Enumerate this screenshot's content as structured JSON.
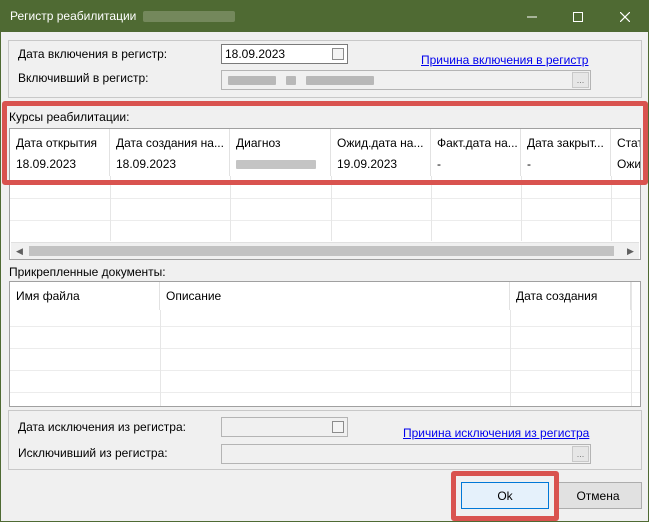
{
  "window": {
    "title": "Регистр реабилитации",
    "controls": {
      "minimize": "minimize",
      "maximize": "maximize",
      "close": "close"
    }
  },
  "inclusion": {
    "date_label": "Дата включения в регистр:",
    "date_value": "18.09.2023",
    "included_by_label": "Включивший в регистр:",
    "picker_button": "...",
    "reason_link": "Причина включения в регистр"
  },
  "courses": {
    "section_label": "Курсы реабилитации:",
    "columns": [
      "Дата открытия",
      "Дата создания на...",
      "Диагноз",
      "Ожид.дата на...",
      "Факт.дата на...",
      "Дата закрыт...",
      "Стат"
    ],
    "rows": [
      [
        "18.09.2023",
        "18.09.2023",
        "",
        "19.09.2023",
        "-",
        "-",
        "Ожи"
      ]
    ],
    "scroll_left": "◀",
    "scroll_right": "▶"
  },
  "documents": {
    "section_label": "Прикрепленные документы:",
    "columns": [
      "Имя файла",
      "Описание",
      "Дата создания"
    ]
  },
  "exclusion": {
    "date_label": "Дата исключения из регистра:",
    "excluded_by_label": "Исключивший из регистра:",
    "picker_button": "...",
    "reason_link": "Причина исключения из регистра"
  },
  "buttons": {
    "ok": "Ok",
    "cancel": "Отмена"
  },
  "colors": {
    "titlebar": "#4f6a33",
    "highlight": "#d9534f",
    "link": "#0000ee"
  }
}
